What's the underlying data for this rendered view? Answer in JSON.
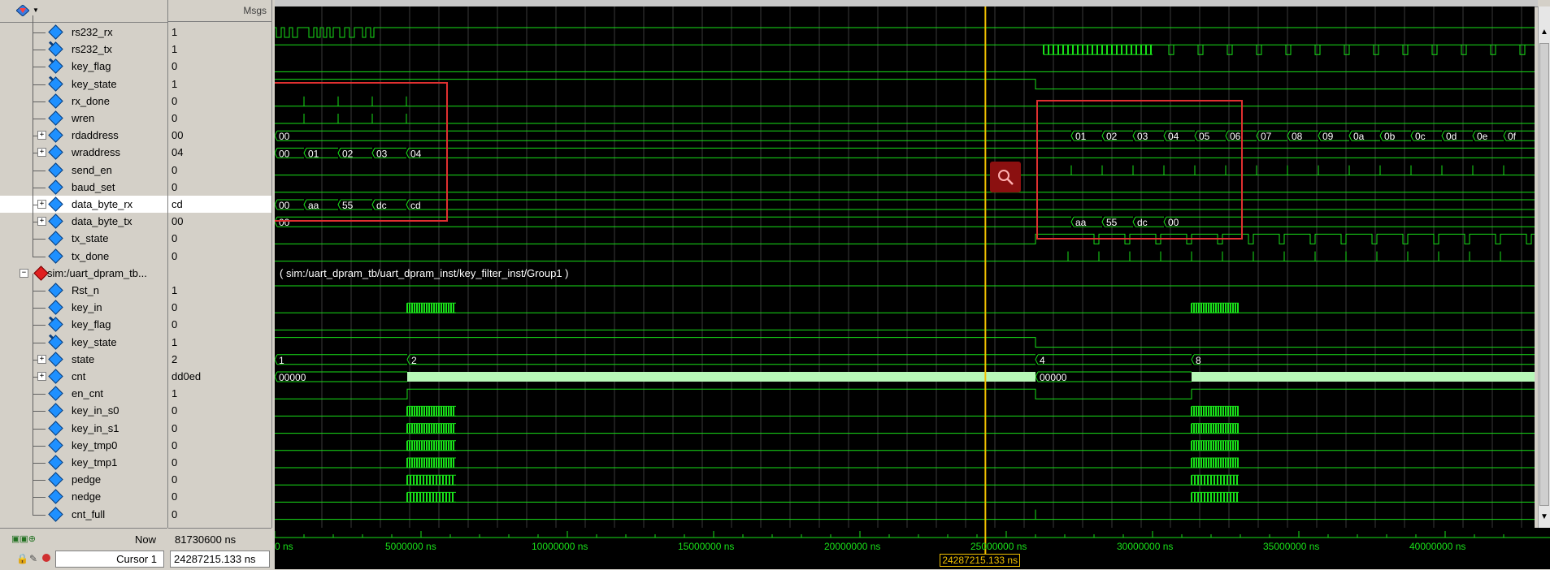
{
  "toolbar": {
    "msgs_header": "Msgs"
  },
  "signals": [
    {
      "name": "rs232_rx",
      "value": "1",
      "indent": 1,
      "expandable": false,
      "icon": "signal-icon"
    },
    {
      "name": "rs232_tx",
      "value": "1",
      "indent": 1,
      "expandable": false,
      "icon": "signal-out-icon"
    },
    {
      "name": "key_flag",
      "value": "0",
      "indent": 1,
      "expandable": false,
      "icon": "signal-out-icon"
    },
    {
      "name": "key_state",
      "value": "1",
      "indent": 1,
      "expandable": false,
      "icon": "signal-out-icon"
    },
    {
      "name": "rx_done",
      "value": "0",
      "indent": 1,
      "expandable": false,
      "icon": "signal-icon"
    },
    {
      "name": "wren",
      "value": "0",
      "indent": 1,
      "expandable": false,
      "icon": "signal-icon"
    },
    {
      "name": "rdaddress",
      "value": "00",
      "indent": 1,
      "expandable": true,
      "icon": "signal-icon"
    },
    {
      "name": "wraddress",
      "value": "04",
      "indent": 1,
      "expandable": true,
      "icon": "signal-icon"
    },
    {
      "name": "send_en",
      "value": "0",
      "indent": 1,
      "expandable": false,
      "icon": "signal-icon"
    },
    {
      "name": "baud_set",
      "value": "0",
      "indent": 1,
      "expandable": false,
      "icon": "signal-icon"
    },
    {
      "name": "data_byte_rx",
      "value": "cd",
      "indent": 1,
      "expandable": true,
      "icon": "signal-icon",
      "selected": true
    },
    {
      "name": "data_byte_tx",
      "value": "00",
      "indent": 1,
      "expandable": true,
      "icon": "signal-icon"
    },
    {
      "name": "tx_state",
      "value": "0",
      "indent": 1,
      "expandable": false,
      "icon": "signal-icon"
    },
    {
      "name": "tx_done",
      "value": "0",
      "indent": 1,
      "expandable": false,
      "icon": "signal-icon"
    },
    {
      "name": "sim:/uart_dpram_tb...",
      "value": "",
      "indent": 0,
      "expandable": true,
      "group": true,
      "icon": "group-icon"
    },
    {
      "name": "Rst_n",
      "value": "1",
      "indent": 1,
      "expandable": false,
      "icon": "signal-icon"
    },
    {
      "name": "key_in",
      "value": "0",
      "indent": 1,
      "expandable": false,
      "icon": "signal-icon"
    },
    {
      "name": "key_flag",
      "value": "0",
      "indent": 1,
      "expandable": false,
      "icon": "signal-out-icon"
    },
    {
      "name": "key_state",
      "value": "1",
      "indent": 1,
      "expandable": false,
      "icon": "signal-out-icon"
    },
    {
      "name": "state",
      "value": "2",
      "indent": 1,
      "expandable": true,
      "icon": "signal-icon"
    },
    {
      "name": "cnt",
      "value": "dd0ed",
      "indent": 1,
      "expandable": true,
      "icon": "signal-icon"
    },
    {
      "name": "en_cnt",
      "value": "1",
      "indent": 1,
      "expandable": false,
      "icon": "signal-icon"
    },
    {
      "name": "key_in_s0",
      "value": "0",
      "indent": 1,
      "expandable": false,
      "icon": "signal-icon"
    },
    {
      "name": "key_in_s1",
      "value": "0",
      "indent": 1,
      "expandable": false,
      "icon": "signal-icon"
    },
    {
      "name": "key_tmp0",
      "value": "0",
      "indent": 1,
      "expandable": false,
      "icon": "signal-icon"
    },
    {
      "name": "key_tmp1",
      "value": "0",
      "indent": 1,
      "expandable": false,
      "icon": "signal-icon"
    },
    {
      "name": "pedge",
      "value": "0",
      "indent": 1,
      "expandable": false,
      "icon": "signal-icon"
    },
    {
      "name": "nedge",
      "value": "0",
      "indent": 1,
      "expandable": false,
      "icon": "signal-icon"
    },
    {
      "name": "cnt_full",
      "value": "0",
      "indent": 1,
      "expandable": false,
      "icon": "signal-icon"
    }
  ],
  "wave_labels": {
    "rdaddress": [
      "00",
      "01",
      "02",
      "03",
      "04",
      "05",
      "06",
      "07",
      "08",
      "09",
      "0a",
      "0b",
      "0c",
      "0d",
      "0e",
      "0f"
    ],
    "wraddress": [
      "00",
      "01",
      "02",
      "03",
      "04"
    ],
    "data_byte_rx": [
      "00",
      "aa",
      "55",
      "dc",
      "cd"
    ],
    "data_byte_tx_left": [
      "00"
    ],
    "data_byte_tx_right": [
      "aa",
      "55",
      "dc",
      "00"
    ],
    "group_path": "( sim:/uart_dpram_tb/uart_dpram_inst/key_filter_inst/Group1 )",
    "state": [
      "1",
      "2",
      "4",
      "8"
    ],
    "cnt": [
      "00000",
      "00000"
    ]
  },
  "footer": {
    "now_label": "Now",
    "now_value": "81730600 ns",
    "cursor_label": "Cursor 1",
    "cursor_value": "24287215.133 ns",
    "cursor_readout": "24287215.133 ns"
  },
  "timeline": {
    "unit": "ns",
    "ticks": [
      "0 ns",
      "5000000 ns",
      "10000000 ns",
      "15000000 ns",
      "20000000 ns",
      "25000000 ns",
      "30000000 ns",
      "35000000 ns",
      "40000000 ns"
    ],
    "tick_values": [
      0,
      5000000,
      10000000,
      15000000,
      20000000,
      25000000,
      30000000,
      35000000,
      40000000
    ],
    "cursor_time": 24287215.133
  },
  "colors": {
    "wave": "#19e019",
    "cursor": "#f0c000",
    "highlight_box": "#e03030",
    "background": "#000000"
  }
}
